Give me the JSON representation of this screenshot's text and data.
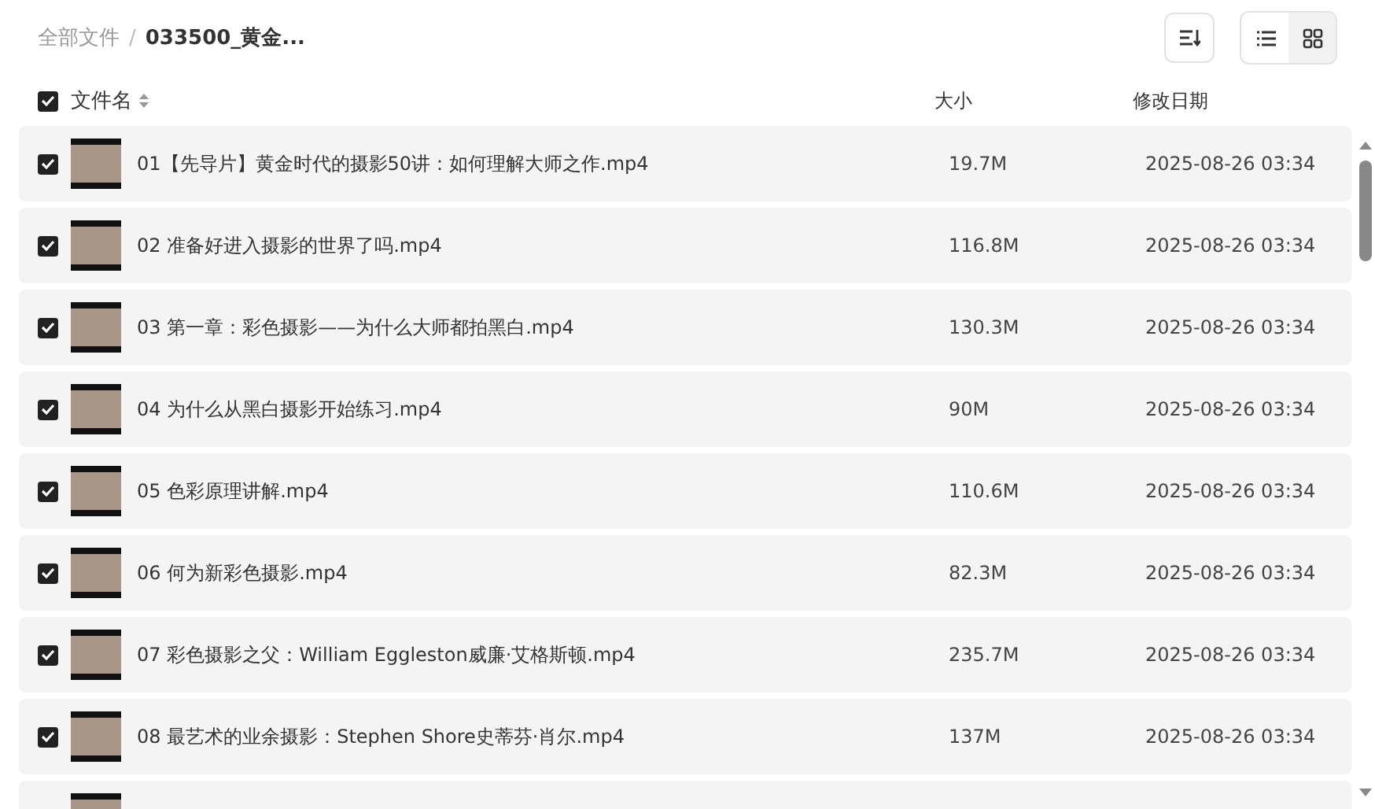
{
  "breadcrumb_separator": "/",
  "breadcrumb": [
    {
      "label": "全部文件",
      "current": false
    },
    {
      "label": "033500_黄金...",
      "current": true
    }
  ],
  "toolbar": {
    "view_modes": [
      {
        "kind": "list",
        "selected": true
      },
      {
        "kind": "grid",
        "selected": false
      }
    ]
  },
  "table": {
    "all_checked": true,
    "columns": [
      "文件名",
      "大小",
      "修改日期"
    ],
    "rows": [
      {
        "checked": true,
        "name": "01【先导片】黄金时代的摄影50讲：如何理解大师之作.mp4",
        "size": "19.7M",
        "modified": "2025-08-26 03:34"
      },
      {
        "checked": true,
        "name": "02 准备好进入摄影的世界了吗.mp4",
        "size": "116.8M",
        "modified": "2025-08-26 03:34"
      },
      {
        "checked": true,
        "name": "03 第一章：彩色摄影——为什么大师都拍黑白.mp4",
        "size": "130.3M",
        "modified": "2025-08-26 03:34"
      },
      {
        "checked": true,
        "name": "04 为什么从黑白摄影开始练习.mp4",
        "size": "90M",
        "modified": "2025-08-26 03:34"
      },
      {
        "checked": true,
        "name": "05 色彩原理讲解.mp4",
        "size": "110.6M",
        "modified": "2025-08-26 03:34"
      },
      {
        "checked": true,
        "name": "06 何为新彩色摄影.mp4",
        "size": "82.3M",
        "modified": "2025-08-26 03:34"
      },
      {
        "checked": true,
        "name": "07 彩色摄影之父：William Eggleston威廉·艾格斯顿.mp4",
        "size": "235.7M",
        "modified": "2025-08-26 03:34"
      },
      {
        "checked": true,
        "name": "08 最艺术的业余摄影：Stephen Shore史蒂芬·肖尔.mp4",
        "size": "137M",
        "modified": "2025-08-26 03:34"
      },
      {
        "kind": "partial"
      }
    ]
  }
}
